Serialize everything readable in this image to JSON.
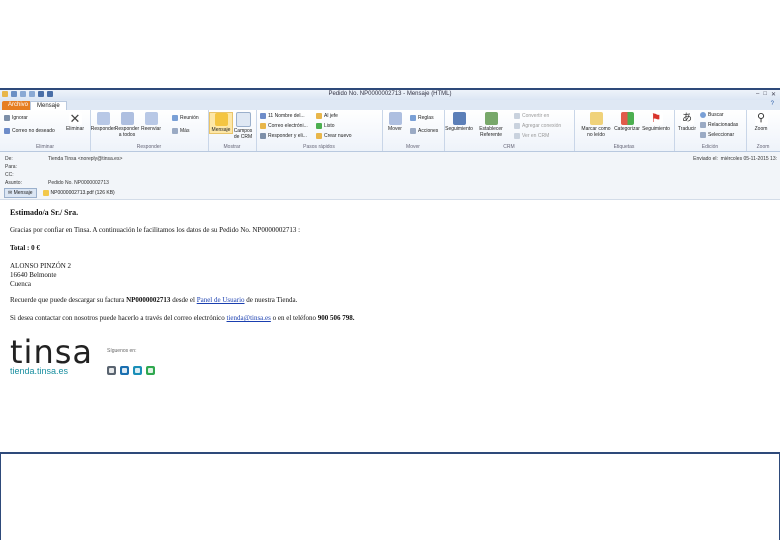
{
  "window": {
    "title": "Pedido No. NP0000002713  -  Mensaje (HTML)",
    "controls": [
      "–",
      "□",
      "✕"
    ]
  },
  "tabs": [
    {
      "label": "Archivo"
    },
    {
      "label": "Mensaje"
    }
  ],
  "ribbon": {
    "groups": {
      "eliminar": {
        "label": "Eliminar",
        "ignorar": "Ignorar",
        "correo_no_deseado": "Correo no deseado",
        "eliminar_btn": "Eliminar"
      },
      "responder": {
        "label": "Responder",
        "responder": "Responder",
        "responder_a_todos": "Responder a todos",
        "reenviar": "Reenviar",
        "reunion": "Reunión",
        "mas": "Más"
      },
      "mostrar": {
        "label": "Mostrar",
        "mensaje": "Mensaje",
        "campos_crm": "Campos de CRM"
      },
      "pasos_rapidos": {
        "label": "Pasos rápidos",
        "items": [
          "11 Nombre del...",
          "Correo electróni...",
          "Responder y eli...",
          "Al jefe",
          "Listo",
          "Crear nuevo"
        ]
      },
      "mover": {
        "label": "Mover",
        "mover": "Mover",
        "reglas": "Reglas",
        "acciones": "Acciones"
      },
      "crm": {
        "label": "CRM",
        "seguimiento": "Seguimiento",
        "establecer_referente": "Establecer Referente",
        "items": [
          "Convertir en",
          "Agregar conexión",
          "Ver en CRM"
        ]
      },
      "etiquetas": {
        "label": "Etiquetas",
        "marcar_no_leido": "Marcar como no leído",
        "categorizar": "Categorizar",
        "seguimiento": "Seguimiento"
      },
      "edicion": {
        "label": "Edición",
        "traducir": "Traducir",
        "buscar": "Buscar",
        "relacionadas": "Relacionadas",
        "seleccionar": "Seleccionar"
      },
      "zoom": {
        "label": "Zoom",
        "zoom": "Zoom"
      }
    }
  },
  "header": {
    "de_label": "De:",
    "de_value": "Tienda Tinsa <noreply@tinsa.es>",
    "para_label": "Para:",
    "cc_label": "CC:",
    "asunto_label": "Asunto:",
    "asunto_value": "Pedido No. NP0000002713",
    "enviado_label": "Enviado el:",
    "enviado_value": "miércoles 05-11-2015 13:",
    "attachments": {
      "mensaje": "Mensaje",
      "file": "NP0000002713.pdf (126 KB)"
    }
  },
  "email": {
    "greeting": "Estimado/a Sr./ Sra.",
    "intro": "Gracias por confiar en Tinsa. A continuación le facilitamos los datos de su Pedido No. NP0000002713 :",
    "total_label": "Total : 0 €",
    "address": [
      "ALONSO PINZÓN 2",
      "16640 Belmonte",
      "Cuenca"
    ],
    "download_pre": "Recuerde que puede descargar su factura ",
    "download_invoice": "NP0000002713",
    "download_mid": " desde el ",
    "download_link": "Panel de Usuario",
    "download_post": " de nuestra Tienda.",
    "contact_pre": "Si desea contactar con nosotros puede hacerlo a través del correo electrónico ",
    "contact_email": "tienda@tinsa.es",
    "contact_mid": " o en el teléfono ",
    "contact_phone": "900 506 798."
  },
  "footer": {
    "logo_word": "tinsa",
    "logo_domain": "tienda.tinsa.es",
    "follow_label": "Síguenos en:",
    "social_icons": [
      "blog-icon",
      "linkedin-icon",
      "twitter-icon",
      "chat-icon"
    ]
  },
  "colors": {
    "file_tab": "#e67e22",
    "accent_blue": "#2e4a7a",
    "link": "#1a3fb0",
    "logo_teal": "#1a8fa0"
  }
}
